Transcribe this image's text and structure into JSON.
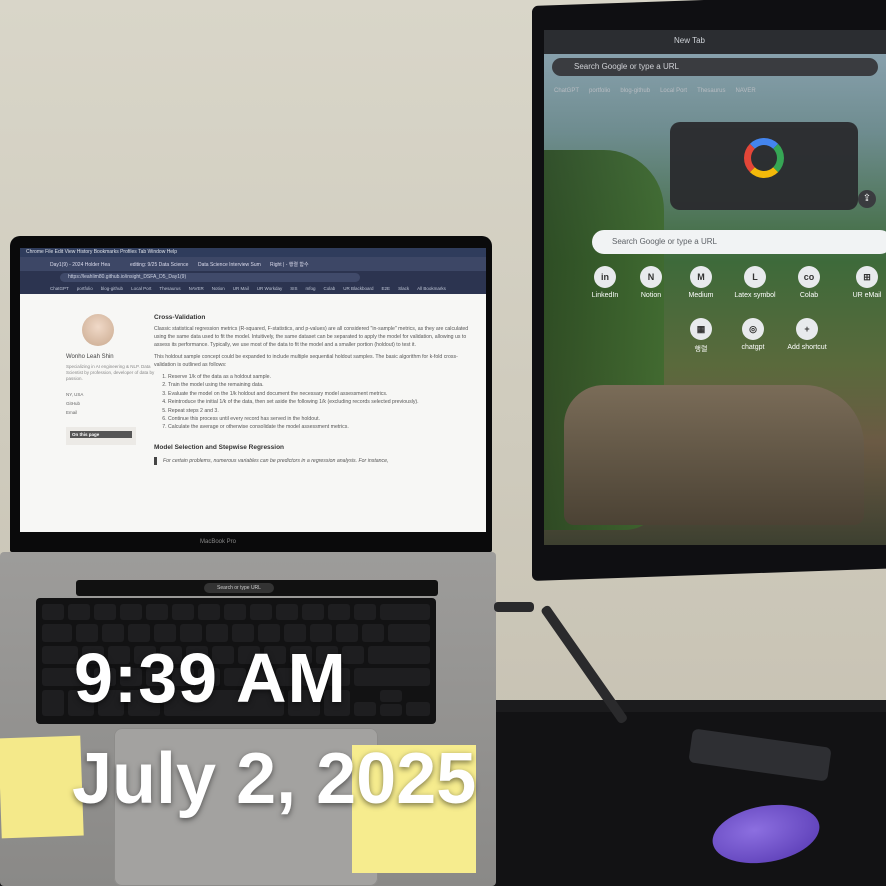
{
  "overlay": {
    "time": "9:39 AM",
    "date": "July 2, 2025"
  },
  "laptop": {
    "model_label": "MacBook Pro",
    "menubar": "Chrome  File  Edit  View  History  Bookmarks  Profiles  Tab  Window  Help",
    "tabs": [
      "Day1(9) - 2024 Holder Hea",
      "editing: 9/25 Data Science",
      "Data Science Interview Sum",
      "Right | - 행렬 함수"
    ],
    "url": "https://leahlim80.github.io/insight_DSFA_D5_Day1(9)",
    "bookmarks": [
      "ChatGPT",
      "portfolio",
      "blog-github",
      "Local Port",
      "Thesaurus",
      "NAVER",
      "Notion",
      "UR Mail",
      "UR Workday",
      "SIS",
      "mfog",
      "Colab",
      "UR Blackboard",
      "E2E",
      "Slack",
      "All Bookmarks"
    ],
    "sidebar": {
      "name": "Wonho Leah Shin",
      "bio": "Specializing in AI engineering & NLP. Data Scientist by profession, developer of data by passion.",
      "links": [
        "NY, USA",
        "GitHub",
        "Email"
      ],
      "toc_title": "On this page"
    },
    "content": {
      "heading1": "Cross-Validation",
      "para1": "Classic statistical regression metrics (R-squared, F-statistics, and p-values) are all considered \"in-sample\" metrics, as they are calculated using the same data used to fit the model. Intuitively, the same dataset can be separated to apply the model for validation, allowing us to assess its performance. Typically, we use most of the data to fit the model and a smaller portion (holdout) to test it.",
      "para2": "This holdout sample concept could be expanded to include multiple sequential holdout samples. The basic algorithm for k-fold cross-validation is outlined as follows:",
      "steps": [
        "Reserve 1/k of the data as a holdout sample.",
        "Train the model using the remaining data.",
        "Evaluate the model on the 1/k holdout and document the necessary model assessment metrics.",
        "Reintroduce the initial 1/k of the data, then set aside the following 1/k (excluding records selected previously).",
        "Repeat steps 2 and 3.",
        "Continue this process until every record has served in the holdout.",
        "Calculate the average or otherwise consolidate the model assessment metrics."
      ],
      "heading2": "Model Selection and Stepwise Regression",
      "note": "For certain problems, numerous variables can be predictors in a regression analysis. For instance,"
    },
    "touchbar": {
      "search": "Search or type URL"
    }
  },
  "monitor": {
    "tab_title": "New Tab",
    "address": "Search Google or type a URL",
    "bookmarks": [
      "ChatGPT",
      "portfolio",
      "blog-github",
      "Local Port",
      "Thesaurus",
      "NAVER"
    ],
    "search_placeholder": "Search Google or type a URL",
    "shortcuts": [
      {
        "label": "LinkedIn",
        "glyph": "in"
      },
      {
        "label": "Notion",
        "glyph": "N"
      },
      {
        "label": "Medium",
        "glyph": "M"
      },
      {
        "label": "Latex symbol",
        "glyph": "L"
      },
      {
        "label": "Colab",
        "glyph": "co"
      },
      {
        "label": "UR eMail",
        "glyph": "⊞"
      },
      {
        "label": "행렬",
        "glyph": "▦"
      },
      {
        "label": "chatgpt",
        "glyph": "◎"
      },
      {
        "label": "Add shortcut",
        "glyph": "+"
      }
    ]
  }
}
